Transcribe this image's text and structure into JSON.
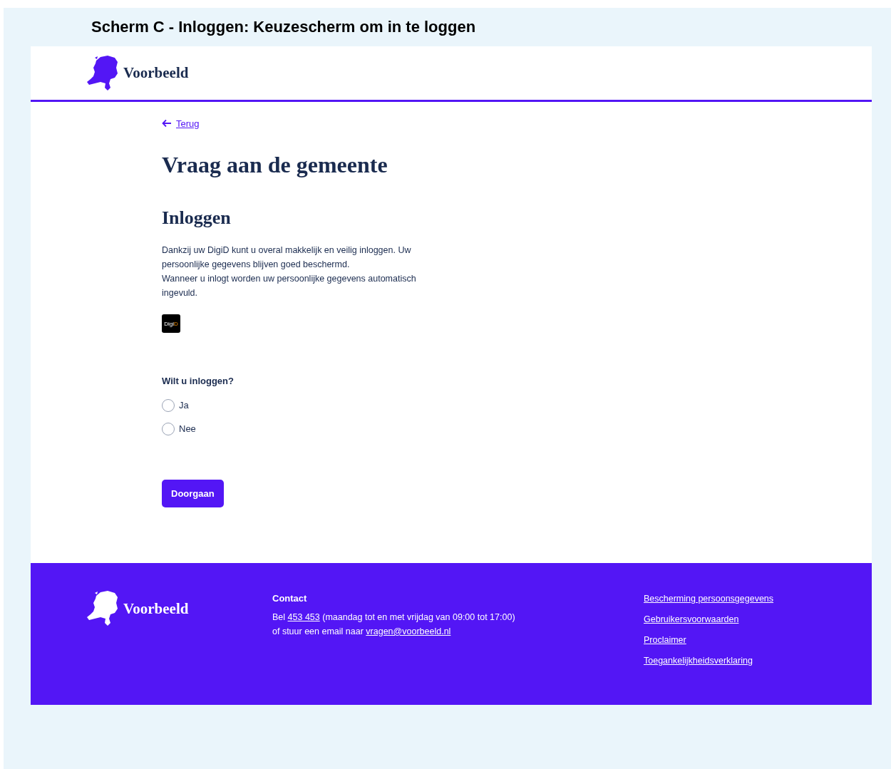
{
  "caption": "Scherm C - Inloggen: Keuzescherm om in te loggen",
  "header": {
    "brand": "Voorbeeld"
  },
  "back_link": "Terug",
  "page_title": "Vraag aan de gemeente",
  "section_title": "Inloggen",
  "intro": [
    "Dankzij uw DigiD kunt u overal makkelijk en veilig inloggen. Uw persoonlijke gegevens blijven goed beschermd.",
    "Wanneer u inlogt worden uw persoonlijke gegevens automatisch ingevuld."
  ],
  "digid_logo": {
    "text": "Digi",
    "accent": "D"
  },
  "question": {
    "label": "Wilt u inloggen?",
    "options": [
      {
        "label": "Ja",
        "selected": false
      },
      {
        "label": "Nee",
        "selected": false
      }
    ]
  },
  "submit_button": "Doorgaan",
  "footer": {
    "brand": "Voorbeeld",
    "contact": {
      "title": "Contact",
      "phone_prefix": "Bel",
      "phone": "453 453",
      "phone_suffix": "(maandag tot en met vrijdag van 09:00 tot 17:00)",
      "email_prefix": "of stuur een email naar",
      "email": "vragen@voorbeeld.nl"
    },
    "links": [
      "Bescherming persoonsgegevens",
      "Gebruikersvoorwaarden",
      "Proclaimer",
      "Toegankelijkheidsverklaring"
    ]
  }
}
